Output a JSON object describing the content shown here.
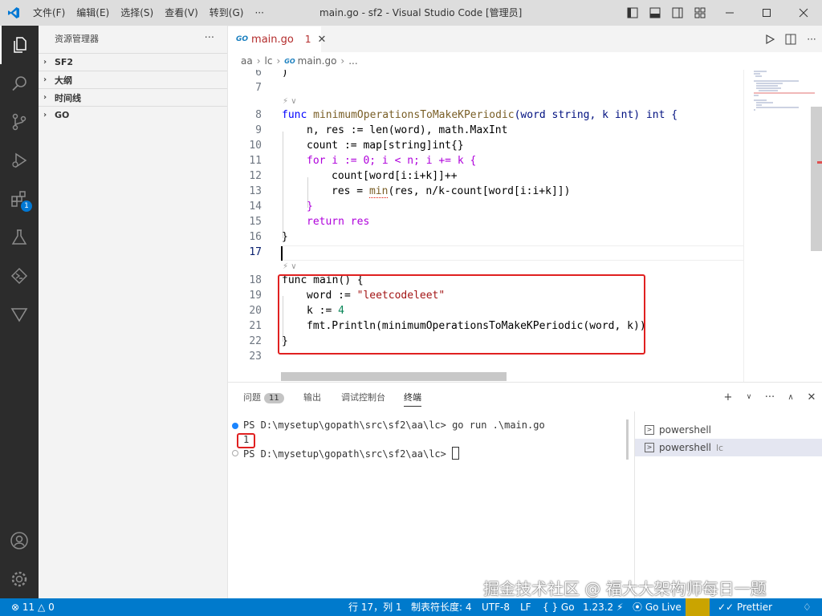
{
  "titlebar": {
    "menu": [
      "文件(F)",
      "编辑(E)",
      "选择(S)",
      "查看(V)",
      "转到(G)",
      "···"
    ],
    "title": "main.go - sf2 - Visual Studio Code [管理员]"
  },
  "activity_bar": {
    "extensions_badge": "1"
  },
  "sidebar": {
    "title": "资源管理器",
    "more": "···",
    "sections": [
      "SF2",
      "大纲",
      "时间线",
      "GO"
    ]
  },
  "editor": {
    "tab": {
      "label": "main.go",
      "problems": "1",
      "icon_text": "GO"
    },
    "breadcrumb": [
      "aa",
      "lc",
      "main.go",
      "..."
    ],
    "codelens": "⚡",
    "lines": [
      {
        "n": "6"
      },
      {
        "n": "7"
      },
      {
        "n": "8"
      },
      {
        "n": "9"
      },
      {
        "n": "10"
      },
      {
        "n": "11"
      },
      {
        "n": "12"
      },
      {
        "n": "13"
      },
      {
        "n": "14"
      },
      {
        "n": "15"
      },
      {
        "n": "16"
      },
      {
        "n": "17"
      },
      {
        "n": "18"
      },
      {
        "n": "19"
      },
      {
        "n": "20"
      },
      {
        "n": "21"
      },
      {
        "n": "22"
      },
      {
        "n": "23"
      }
    ],
    "code": {
      "l6": ")",
      "l8_func": "func",
      "l8_name": "minimumOperationsToMakeKPeriodic",
      "l8_params": "(word string, k int) int {",
      "l9": "n, res := len(word), math.MaxInt",
      "l10": "count := map[string]int{}",
      "l11": "for i := 0; i < n; i += k {",
      "l12": "count[word[i:i+k]]++",
      "l13_a": "res = ",
      "l13_min": "min",
      "l13_b": "(res, n/k-count[word[i:i+k]])",
      "l14": "}",
      "l15": "return res",
      "l16": "}",
      "l18": "func main() {",
      "l19_a": "word := ",
      "l19_str": "\"leetcodeleet\"",
      "l20_a": "k := ",
      "l20_num": "4",
      "l21": "fmt.Println(minimumOperationsToMakeKPeriodic(word, k))",
      "l22": "}"
    }
  },
  "panel": {
    "tabs": [
      "问题",
      "输出",
      "调试控制台",
      "终端"
    ],
    "problems_count": "11",
    "terminal_lines": [
      "PS D:\\mysetup\\gopath\\src\\sf2\\aa\\lc> go run .\\main.go",
      "1",
      "PS D:\\mysetup\\gopath\\src\\sf2\\aa\\lc> "
    ],
    "terminals": [
      {
        "label": "powershell",
        "sub": ""
      },
      {
        "label": "powershell",
        "sub": "lc"
      }
    ]
  },
  "statusbar": {
    "errors": "11",
    "warnings": "0",
    "position": "行 17，列 1",
    "tab_size": "制表符长度: 4",
    "encoding": "UTF-8",
    "eol": "LF",
    "language": "{ } Go",
    "go_version": "1.23.2",
    "go_live": "Go Live",
    "prettier": "Prettier"
  },
  "watermark": "掘金技术社区 @ 福大大架构师每日一题",
  "colors": {
    "statusbar": "#007acc",
    "activitybar": "#2c2c2c",
    "highlight_box": "#e02020"
  }
}
